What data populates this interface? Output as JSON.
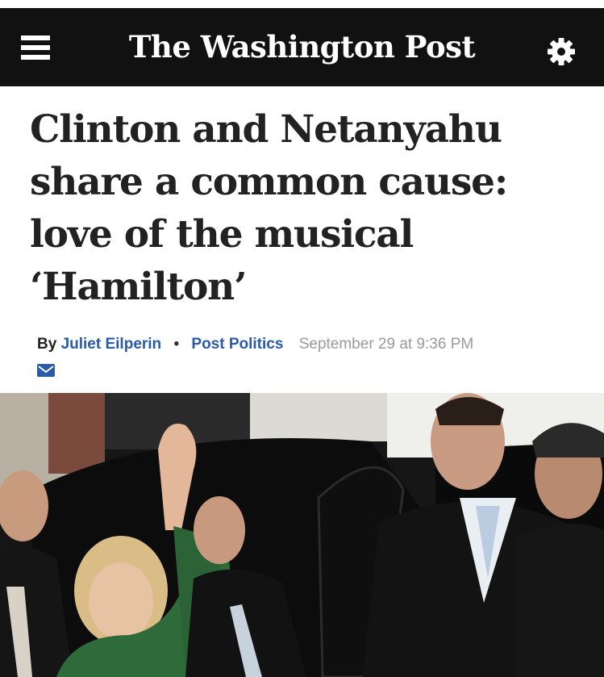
{
  "header": {
    "masthead": "The Washington Post",
    "menu_icon": "hamburger-menu-icon",
    "settings_icon": "gear-icon",
    "background": "#111111"
  },
  "article": {
    "headline": "Clinton and Netanyahu share a common cause: love of the musical ‘Hamilton’",
    "byline": {
      "prefix": "By",
      "author": "Juliet Eilperin",
      "separator": "•",
      "section": "Post Politics",
      "timestamp": "September 29 at 9:36 PM"
    },
    "email_icon": "envelope-icon",
    "link_color": "#2a5aa8"
  },
  "photo": {
    "subject": "news-photo"
  }
}
